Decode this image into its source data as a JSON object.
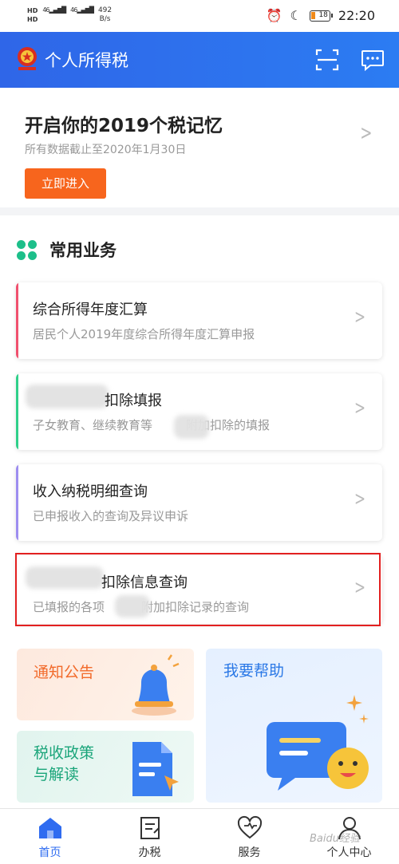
{
  "status_bar": {
    "hd1": "HD",
    "hd2": "HD",
    "sig1": "46",
    "sig2": "46",
    "speed_value": "492",
    "speed_unit": "B/s",
    "battery": "18",
    "time": "22:20"
  },
  "header": {
    "title": "个人所得税",
    "scan_icon": "scan-icon",
    "message_icon": "message-icon",
    "brand_color": "#2f66e8"
  },
  "banner": {
    "title": "开启你的2019个税记忆",
    "subtitle": "所有数据截止至2020年1月30日",
    "button_label": "立即进入",
    "button_color": "#f7651d"
  },
  "services": {
    "title": "常用业务",
    "items": [
      {
        "title": "综合所得年度汇算",
        "desc": "居民个人2019年度综合所得年度汇算申报",
        "accent": "#f0506e"
      },
      {
        "title": "扣除填报",
        "desc_a": "子女教育、继续教育等",
        "desc_b": "附加扣除的填报",
        "accent": "#2fd08a"
      },
      {
        "title": "收入纳税明细查询",
        "desc": "已申报收入的查询及异议申诉",
        "accent": "#9d8df0"
      },
      {
        "title": "扣除信息查询",
        "desc_a": "已填报的各项",
        "desc_b": "附加扣除记录的查询",
        "accent": "#ffffff"
      }
    ]
  },
  "promos": {
    "notice": "通知公告",
    "policy_line1": "税收政策",
    "policy_line2": "与解读",
    "help": "我要帮助"
  },
  "tabbar": {
    "items": [
      {
        "label": "首页",
        "icon": "home-icon"
      },
      {
        "label": "办税",
        "icon": "tax-document-icon"
      },
      {
        "label": "服务",
        "icon": "service-heart-icon"
      },
      {
        "label": "个人中心",
        "icon": "user-icon"
      }
    ],
    "active_color": "#2f6cf0"
  },
  "watermark": "Baidu经验"
}
